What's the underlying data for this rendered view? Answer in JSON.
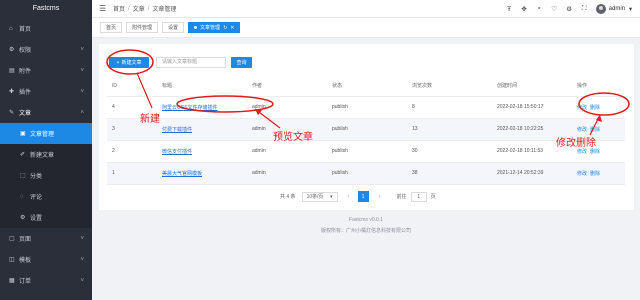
{
  "app": {
    "logo": "Fastcms"
  },
  "sidebar": {
    "items": [
      {
        "label": "首页",
        "icon": "home-icon",
        "glyph": "⌂",
        "chevron": false
      },
      {
        "label": "权限",
        "icon": "gear-icon",
        "glyph": "⚙",
        "chevron": true
      },
      {
        "label": "附件",
        "icon": "folder-icon",
        "glyph": "▤",
        "chevron": true
      },
      {
        "label": "插件",
        "icon": "plugin-icon",
        "glyph": "✚",
        "chevron": true
      },
      {
        "label": "文章",
        "icon": "article-icon",
        "glyph": "✎",
        "chevron": true,
        "open": true
      },
      {
        "label": "文章管理",
        "icon": "manage-icon",
        "glyph": "▣",
        "sub": true,
        "active": true
      },
      {
        "label": "新建文章",
        "icon": "edit-icon",
        "glyph": "✐",
        "sub": true
      },
      {
        "label": "分类",
        "icon": "category-icon",
        "glyph": "⬚",
        "sub": true
      },
      {
        "label": "评论",
        "icon": "comment-icon",
        "glyph": "◌",
        "sub": true
      },
      {
        "label": "设置",
        "icon": "settings-icon",
        "glyph": "⚙",
        "sub": true
      },
      {
        "label": "页面",
        "icon": "page-icon",
        "glyph": "▢",
        "chevron": true
      },
      {
        "label": "模板",
        "icon": "template-icon",
        "glyph": "◫",
        "chevron": true
      },
      {
        "label": "订单",
        "icon": "order-icon",
        "glyph": "▦",
        "chevron": true
      }
    ]
  },
  "header": {
    "breadcrumbs": [
      "首页",
      "文章",
      "文章管理"
    ],
    "user_name": "admin"
  },
  "tabs": [
    {
      "label": "首页"
    },
    {
      "label": "附件管理"
    },
    {
      "label": "设置"
    },
    {
      "label": "文章管理",
      "active": true
    }
  ],
  "toolbar": {
    "new_label": "新建文章",
    "search_placeholder": "请输入文章标题",
    "search_label": "查询"
  },
  "table": {
    "headers": [
      "ID",
      "标题",
      "作者",
      "状态",
      "浏览次数",
      "创建时间",
      "操作"
    ],
    "rows": [
      {
        "id": "4",
        "title": "阿里云OSS文件存储插件",
        "author": "admin",
        "status": "publish",
        "views": "8",
        "created": "2022-02-18 15:50:17"
      },
      {
        "id": "3",
        "title": "付费下载插件",
        "author": "admin",
        "status": "publish",
        "views": "13",
        "created": "2022-02-18 10:22:25"
      },
      {
        "id": "2",
        "title": "微信支付插件",
        "author": "admin",
        "status": "publish",
        "views": "30",
        "created": "2022-02-18 10:11:53"
      },
      {
        "id": "1",
        "title": "美晨大气官网模板",
        "author": "admin",
        "status": "publish",
        "views": "38",
        "created": "2021-12-14 20:52:39"
      }
    ],
    "edit_label": "修改",
    "delete_label": "删除"
  },
  "pagination": {
    "total": "共 4 条",
    "page_size": "10条/页",
    "current": "1",
    "goto": "前往",
    "goto_value": "1",
    "page_suffix": "页"
  },
  "footer": {
    "version": "Fastcms v0.0.1",
    "copyright": "版权所有：广州小橘灯信息科技有限公司"
  },
  "annotations": {
    "new": "新建",
    "preview": "预览文章",
    "edit_delete": "修改删除",
    "color": "#e01b1b"
  }
}
